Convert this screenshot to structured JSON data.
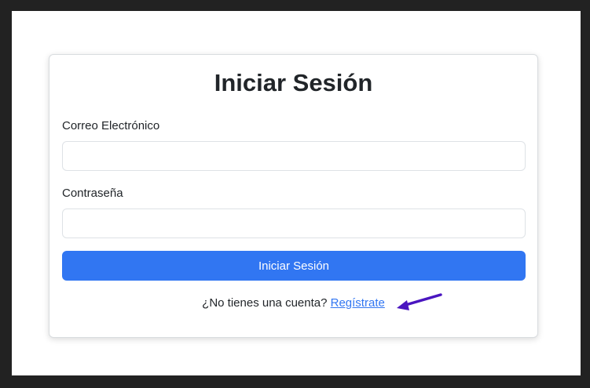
{
  "login": {
    "title": "Iniciar Sesión",
    "email_label": "Correo Electrónico",
    "email_value": "",
    "password_label": "Contraseña",
    "password_value": "",
    "submit_label": "Iniciar Sesión",
    "signup_prompt": "¿No tienes una cuenta?",
    "signup_link": "Regístrate"
  },
  "annotation": {
    "arrow_icon": "arrow-pointer-icon",
    "arrow_color": "#4a16c0"
  },
  "colors": {
    "primary": "#3176f2",
    "background_outer": "#222222",
    "text": "#212529"
  }
}
